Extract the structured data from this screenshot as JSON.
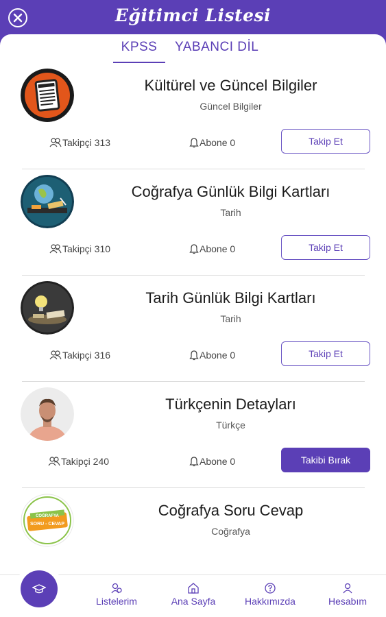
{
  "header": {
    "title": "Eğitimci Listesi"
  },
  "tabs": [
    {
      "label": "KPSS"
    },
    {
      "label": "YABANCI DİL"
    }
  ],
  "items": [
    {
      "title": "Kültürel ve Güncel  Bilgiler",
      "subtitle": "Güncel Bilgiler",
      "followers": "Takipçi 313",
      "subscribers": "Abone 0",
      "button": "Takip Et",
      "following": false
    },
    {
      "title": "Coğrafya Günlük  Bilgi Kartları",
      "subtitle": "Tarih",
      "followers": "Takipçi 310",
      "subscribers": "Abone 0",
      "button": "Takip Et",
      "following": false
    },
    {
      "title": "Tarih  Günlük Bilgi Kartları",
      "subtitle": "Tarih",
      "followers": "Takipçi 316",
      "subscribers": "Abone 0",
      "button": "Takip Et",
      "following": false
    },
    {
      "title": "Türkçenin Detayları",
      "subtitle": "Türkçe",
      "followers": "Takipçi 240",
      "subscribers": "Abone 0",
      "button": "Takibi Bırak",
      "following": true
    },
    {
      "title": "Coğrafya Soru Cevap",
      "subtitle": "Coğrafya",
      "followers": "",
      "subscribers": "",
      "button": "",
      "following": false
    }
  ],
  "avatars": {
    "badge_line1": "COĞRAFYA",
    "badge_line2": "SORU - CEVAP"
  },
  "bottom_nav": [
    {
      "label": "Listelerim",
      "icon": "lists-icon"
    },
    {
      "label": "Ana Sayfa",
      "icon": "home-icon"
    },
    {
      "label": "Hakkımızda",
      "icon": "help-icon"
    },
    {
      "label": "Hesabım",
      "icon": "user-icon"
    }
  ],
  "colors": {
    "accent": "#5b3fb6"
  }
}
